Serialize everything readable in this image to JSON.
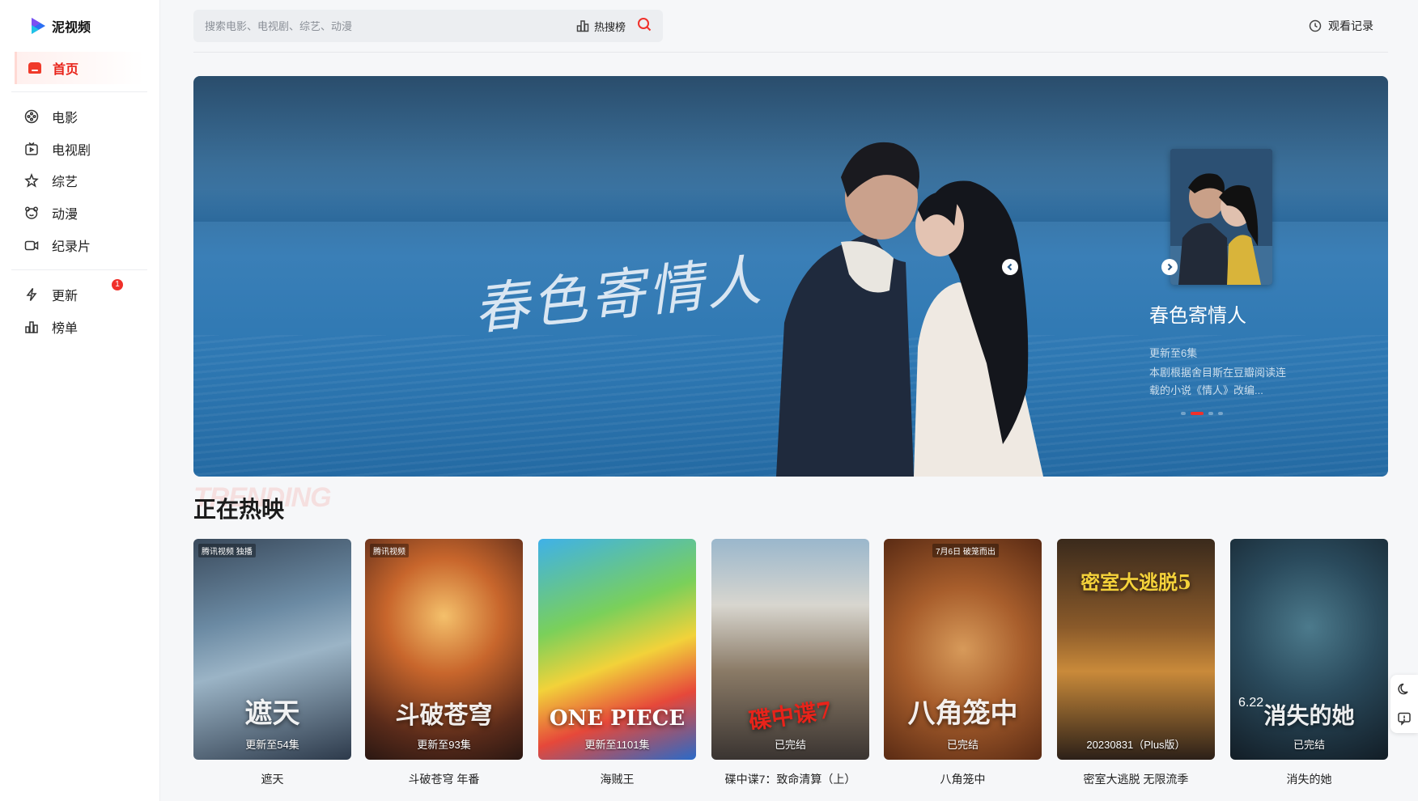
{
  "app": {
    "name": "泥视频"
  },
  "sidebar": {
    "home": "首页",
    "items": [
      {
        "label": "电影",
        "icon": "film-reel-icon"
      },
      {
        "label": "电视剧",
        "icon": "tv-icon"
      },
      {
        "label": "综艺",
        "icon": "star-icon"
      },
      {
        "label": "动漫",
        "icon": "bear-face-icon"
      },
      {
        "label": "纪录片",
        "icon": "camera-icon"
      }
    ],
    "items2": [
      {
        "label": "更新",
        "icon": "lightning-icon",
        "badge": "1"
      },
      {
        "label": "榜单",
        "icon": "chart-bars-icon"
      }
    ]
  },
  "header": {
    "search_placeholder": "搜索电影、电视剧、综艺、动漫",
    "hot_label": "热搜榜",
    "history_label": "观看记录"
  },
  "banner": {
    "calligraphy": "春色寄情人",
    "title": "春色寄情人",
    "status": "更新至6集",
    "desc": "本剧根据舍目斯在豆瓣阅读连载的小说《情人》改编..."
  },
  "section": {
    "bg_text": "TRENDING",
    "title": "正在热映"
  },
  "cards": [
    {
      "title": "遮天",
      "status": "更新至54集",
      "art": "遮天",
      "tag": "腾讯视频 独播"
    },
    {
      "title": "斗破苍穹 年番",
      "status": "更新至93集",
      "art": "斗破苍穹",
      "tag": "腾讯视频"
    },
    {
      "title": "海贼王",
      "status": "更新至1101集",
      "art": "ONE PIECE",
      "tag": ""
    },
    {
      "title": "碟中谍7：致命清算（上）",
      "status": "已完结",
      "art": "碟中谍7",
      "tag": ""
    },
    {
      "title": "八角笼中",
      "status": "已完结",
      "art": "八角笼中",
      "tag": "7月6日 破笼而出"
    },
    {
      "title": "密室大逃脱 无限流季",
      "status": "20230831（Plus版）",
      "art": "密室大逃脱5",
      "tag": ""
    },
    {
      "title": "消失的她",
      "status": "已完结",
      "art": "消失的她",
      "tag": "6.22"
    }
  ],
  "colors": {
    "accent": "#f0302a",
    "banner_blue": "#2e78b3"
  }
}
